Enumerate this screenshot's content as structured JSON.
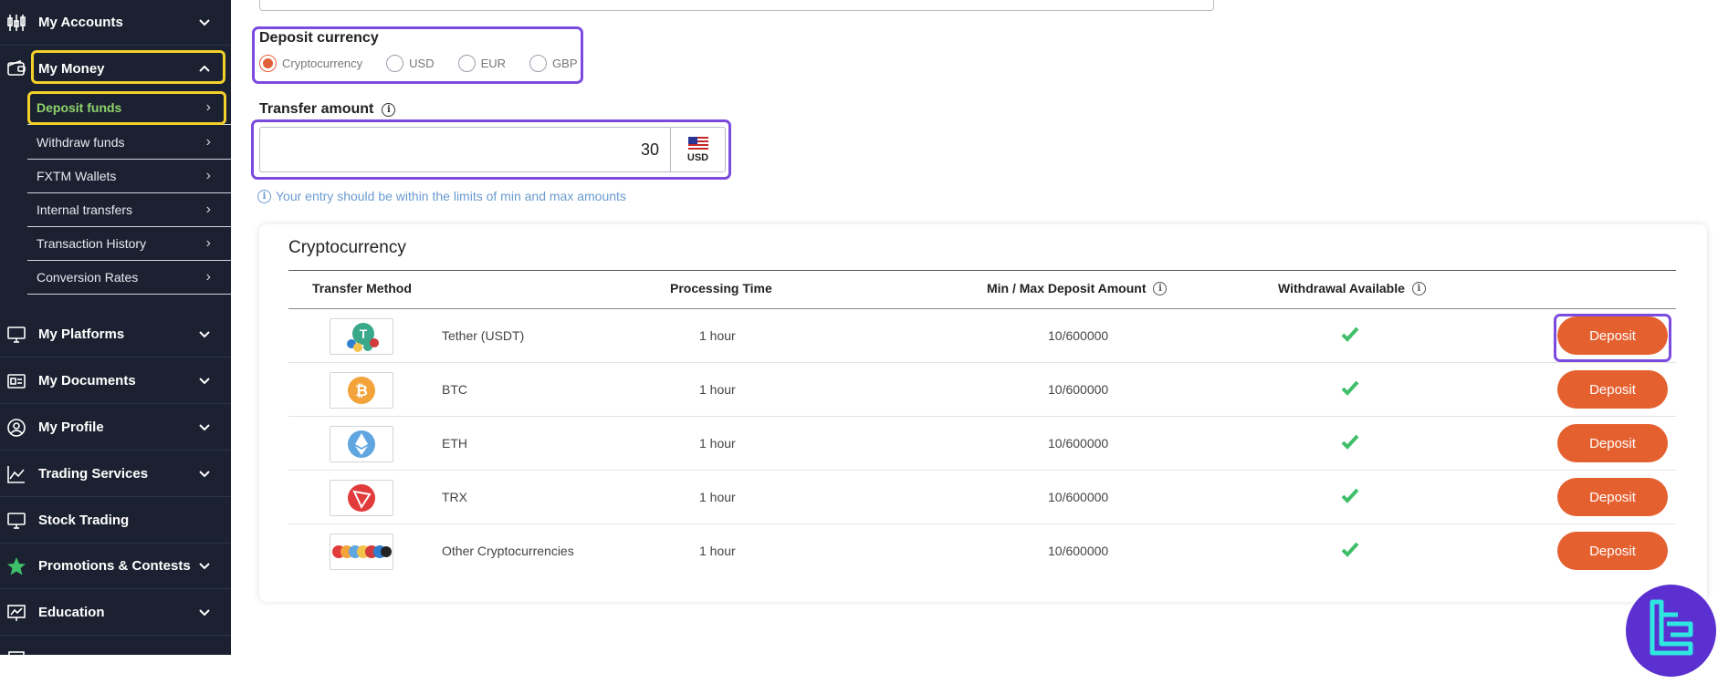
{
  "colors": {
    "sidebar_bg": "#1b2130",
    "active_green": "#8fd36b",
    "accent_orange": "#e5602f",
    "highlight_yellow": "#f3d02a",
    "highlight_purple": "#7b4be0",
    "hint_blue": "#6a9bd0",
    "check_green": "#3fbf6a"
  },
  "sidebar": {
    "items": [
      {
        "label": "My Accounts",
        "icon": "candlestick-chart-icon"
      },
      {
        "label": "My Money",
        "icon": "wallet-icon"
      },
      {
        "label": "My Platforms",
        "icon": "monitor-icon"
      },
      {
        "label": "My Documents",
        "icon": "id-card-icon"
      },
      {
        "label": "My Profile",
        "icon": "user-icon"
      },
      {
        "label": "Trading Services",
        "icon": "line-chart-icon"
      },
      {
        "label": "Stock Trading",
        "icon": "monitor-icon"
      },
      {
        "label": "Promotions & Contests",
        "icon": "star-icon"
      },
      {
        "label": "Education",
        "icon": "chart-board-icon"
      }
    ],
    "money_sub": [
      {
        "label": "Deposit funds",
        "active": true
      },
      {
        "label": "Withdraw funds"
      },
      {
        "label": "FXTM Wallets"
      },
      {
        "label": "Internal transfers"
      },
      {
        "label": "Transaction History"
      },
      {
        "label": "Conversion Rates"
      }
    ]
  },
  "deposit_currency": {
    "label": "Deposit currency",
    "options": [
      "Cryptocurrency",
      "USD",
      "EUR",
      "GBP"
    ],
    "selected": "Cryptocurrency"
  },
  "transfer_amount": {
    "label": "Transfer amount",
    "value": "30",
    "currency": "USD",
    "hint": "Your entry should be within the limits of min and max amounts"
  },
  "table": {
    "title": "Cryptocurrency",
    "headers": {
      "method": "Transfer Method",
      "time": "Processing Time",
      "minmax": "Min / Max Deposit Amount",
      "withdrawal": "Withdrawal Available"
    },
    "rows": [
      {
        "name": "Tether (USDT)",
        "time": "1 hour",
        "minmax": "10/600000",
        "withdrawal": true,
        "action": "Deposit",
        "logo": "tether-logo-icon"
      },
      {
        "name": "BTC",
        "time": "1 hour",
        "minmax": "10/600000",
        "withdrawal": true,
        "action": "Deposit",
        "logo": "bitcoin-logo-icon"
      },
      {
        "name": "ETH",
        "time": "1 hour",
        "minmax": "10/600000",
        "withdrawal": true,
        "action": "Deposit",
        "logo": "ethereum-logo-icon"
      },
      {
        "name": "TRX",
        "time": "1 hour",
        "minmax": "10/600000",
        "withdrawal": true,
        "action": "Deposit",
        "logo": "tron-logo-icon"
      },
      {
        "name": "Other Cryptocurrencies",
        "time": "1 hour",
        "minmax": "10/600000",
        "withdrawal": true,
        "action": "Deposit",
        "logo": "multi-crypto-logo-icon"
      }
    ]
  }
}
